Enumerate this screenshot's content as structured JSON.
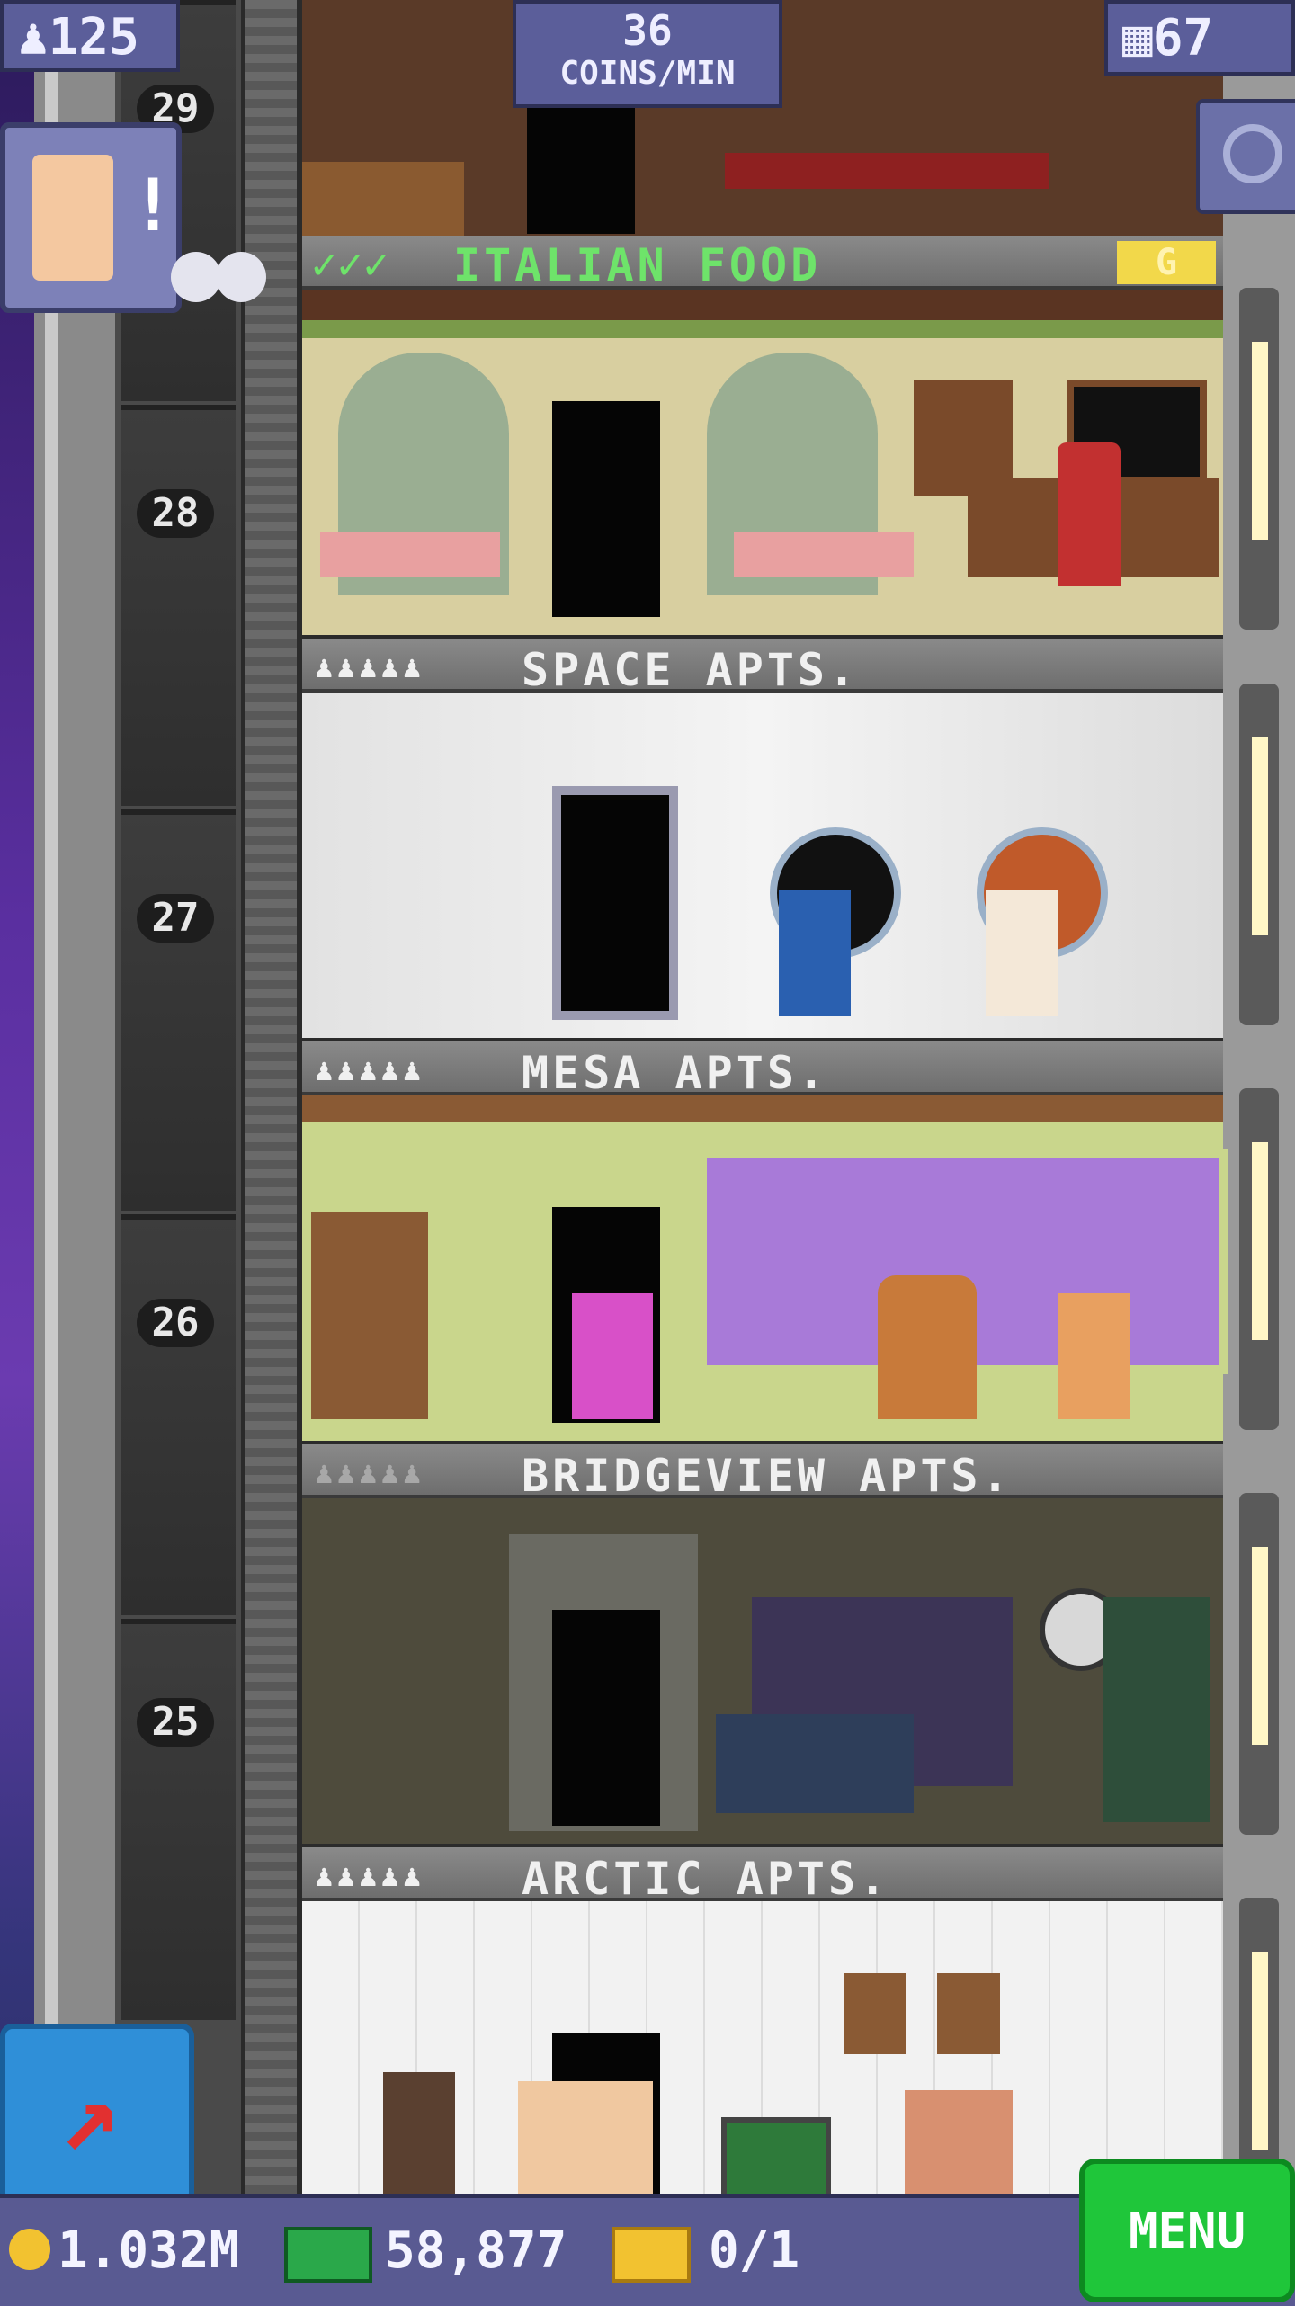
{
  "hud": {
    "population": "125",
    "coins_per_min_value": "36",
    "coins_per_min_label": "COINS/MIN",
    "floor_count": "67"
  },
  "floors": [
    {
      "number": "29",
      "name": "ITALIAN FOOD",
      "checks": "✓✓✓",
      "badge": "G"
    },
    {
      "number": "28",
      "name": "SPACE APTS."
    },
    {
      "number": "27",
      "name": "MESA APTS."
    },
    {
      "number": "26",
      "name": "BRIDGEVIEW APTS."
    },
    {
      "number": "25",
      "name": "ARCTIC APTS."
    }
  ],
  "footer": {
    "coins": "1.032M",
    "bux": "58,877",
    "tickets": "0/1",
    "menu_label": "MENU"
  },
  "colors": {
    "coin": "#f2c230",
    "bux": "#2aa84a",
    "menu": "#1fc63a",
    "check": "#6ee36a"
  }
}
